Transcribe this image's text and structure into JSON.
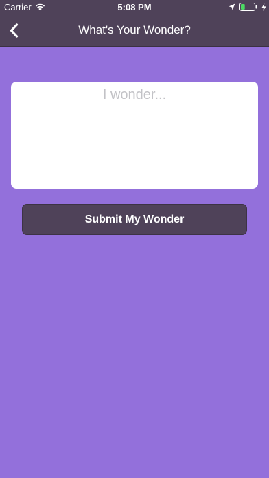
{
  "status_bar": {
    "carrier": "Carrier",
    "time": "5:08 PM",
    "icons": [
      "wifi-icon",
      "location-arrow-icon",
      "battery-icon",
      "charging-bolt-icon"
    ],
    "battery_level": 0.3,
    "battery_color": "#4cd964"
  },
  "nav": {
    "back_icon": "chevron-left-icon",
    "title": "What's Your Wonder?"
  },
  "form": {
    "wonder_placeholder": "I wonder...",
    "wonder_value": "",
    "submit_label": "Submit My Wonder"
  },
  "colors": {
    "background": "#9370db",
    "bar": "#4f4259",
    "button": "#4f4259"
  }
}
